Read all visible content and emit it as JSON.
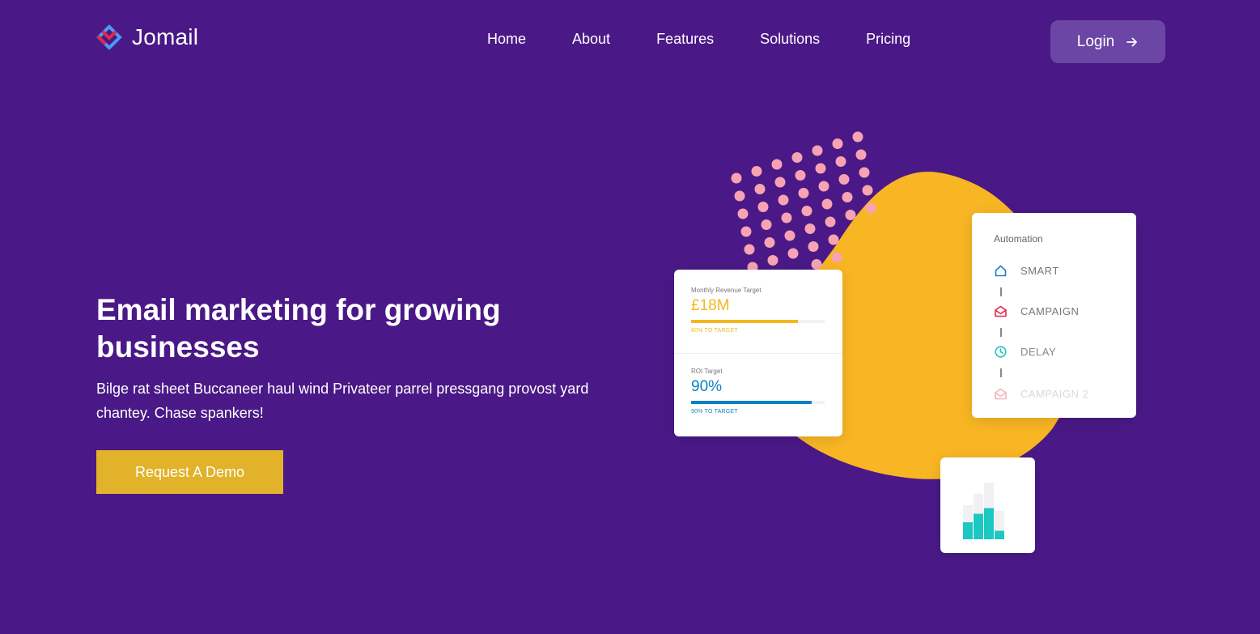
{
  "header": {
    "brand": "Jomail",
    "nav": [
      "Home",
      "About",
      "Features",
      "Solutions",
      "Pricing"
    ],
    "login_label": "Login"
  },
  "hero": {
    "title": "Email marketing for growing businesses",
    "text": "Bilge rat sheet Buccaneer haul wind Privateer parrel pressgang provost yard chantey. Chase spankers!",
    "cta_label": "Request A Demo"
  },
  "revenue_card": {
    "revenue_label": "Monthly Revenue Target",
    "revenue_value": "£18M",
    "revenue_progress": 0.8,
    "revenue_sub": "80% TO TARGET",
    "roi_label": "ROI Target",
    "roi_value": "90%",
    "roi_progress": 0.9,
    "roi_sub": "90% TO TARGET"
  },
  "automation_card": {
    "title": "Automation",
    "steps": [
      {
        "label": "SMART",
        "icon": "home-icon",
        "color": "#1a7fc1"
      },
      {
        "label": "CAMPAIGN",
        "icon": "envelope-icon",
        "color": "#e0294a"
      },
      {
        "label": "DELAY",
        "icon": "clock-icon",
        "color": "#20c4be"
      },
      {
        "label": "CAMPAIGN 2",
        "icon": "envelope-icon",
        "color": "#f2b3c0"
      }
    ]
  },
  "chart_data": {
    "type": "bar",
    "series": [
      {
        "values": [
          3,
          4.5,
          5.5,
          1.5
        ]
      },
      {
        "values": [
          6,
          8,
          10,
          5
        ]
      }
    ]
  },
  "colors": {
    "background": "#4a1987",
    "login_bg": "#6b46a5",
    "cta": "#e1b22a",
    "blob": "#f9b624",
    "dots": "#f7a3b3",
    "revenue": "#f5b71d",
    "roi": "#0b7fc4",
    "bars": "#1cc8c2",
    "bars_bg": "#f1f1f4"
  }
}
